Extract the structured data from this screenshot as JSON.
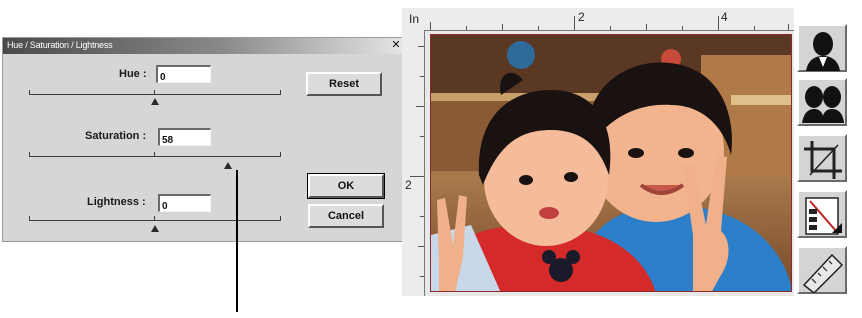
{
  "dialog": {
    "title": "Hue / Saturation / Lightness",
    "hue": {
      "label": "Hue :",
      "value": "0",
      "level": 0
    },
    "saturation": {
      "label": "Saturation :",
      "value": "58",
      "level": 58
    },
    "lightness": {
      "label": "Lightness :",
      "value": "0",
      "level": 0
    },
    "reset_label": "Reset",
    "ok_label": "OK",
    "cancel_label": "Cancel"
  },
  "preview": {
    "ruler_unit": "In",
    "ruler_h_labels": [
      "2",
      "4"
    ],
    "ruler_v_labels": [
      "2"
    ]
  },
  "toolbar": {
    "icons": [
      "single-portrait-icon",
      "two-portraits-icon",
      "crop-icon",
      "text-size-icon",
      "ruler-icon"
    ]
  }
}
